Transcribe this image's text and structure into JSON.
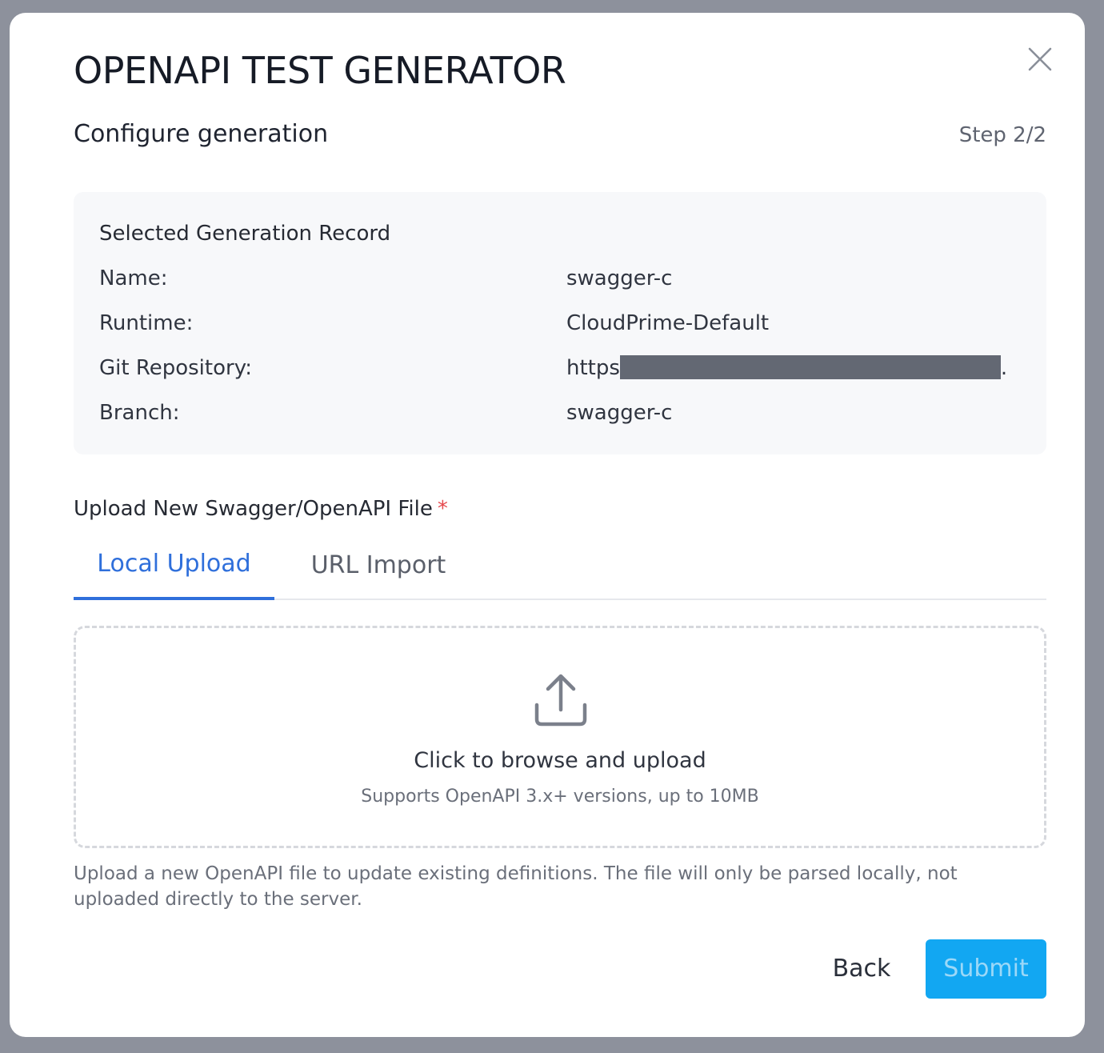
{
  "dialog": {
    "title": "OPENAPI TEST GENERATOR",
    "subtitle": "Configure generation",
    "step": "Step 2/2"
  },
  "record": {
    "title": "Selected Generation Record",
    "rows": [
      {
        "label": "Name:",
        "value": "swagger-c"
      },
      {
        "label": "Runtime:",
        "value": "CloudPrime-Default"
      },
      {
        "label": "Git Repository:",
        "value_prefix": "https",
        "value_suffix": "."
      },
      {
        "label": "Branch:",
        "value": "swagger-c"
      }
    ]
  },
  "upload": {
    "label": "Upload New Swagger/OpenAPI File",
    "required_mark": "*",
    "tabs": [
      {
        "label": "Local Upload",
        "active": true
      },
      {
        "label": "URL Import",
        "active": false
      }
    ],
    "dropzone_main": "Click to browse and upload",
    "dropzone_sub": "Supports OpenAPI 3.x+ versions, up to 10MB",
    "help_text": "Upload a new OpenAPI file to update existing definitions. The file will only be parsed locally, not uploaded directly to the server."
  },
  "footer": {
    "back_label": "Back",
    "submit_label": "Submit"
  },
  "icons": {
    "close": "close-icon",
    "upload": "upload-icon"
  },
  "colors": {
    "accent": "#2f6fdb",
    "submit_bg": "#12a7f2",
    "required": "#e5484d",
    "redaction": "#636873"
  }
}
